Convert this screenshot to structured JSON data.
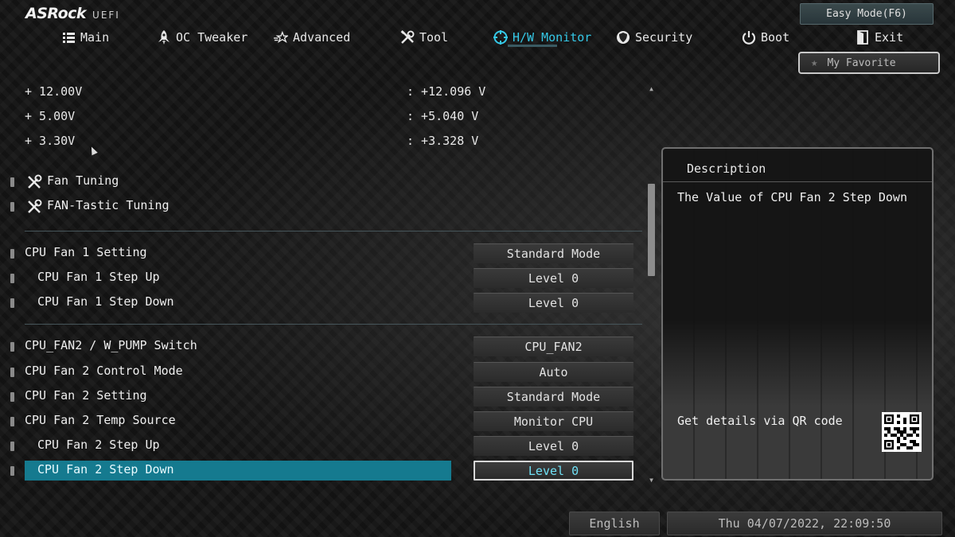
{
  "header": {
    "brand": "ASRock",
    "brand_suffix": "UEFI",
    "easy_mode_label": "Easy Mode(F6)",
    "favorite_label": "My Favorite"
  },
  "nav": {
    "active": "H/W Monitor",
    "items": [
      {
        "label": "Main",
        "icon": "list-icon"
      },
      {
        "label": "OC Tweaker",
        "icon": "rocket-icon"
      },
      {
        "label": "Advanced",
        "icon": "star-icon"
      },
      {
        "label": "Tool",
        "icon": "tools-icon"
      },
      {
        "label": "H/W Monitor",
        "icon": "target-icon"
      },
      {
        "label": "Security",
        "icon": "shield-icon"
      },
      {
        "label": "Boot",
        "icon": "power-icon"
      },
      {
        "label": "Exit",
        "icon": "exit-door-icon"
      }
    ]
  },
  "voltages": [
    {
      "name": "+ 12.00V",
      "value": ": +12.096 V"
    },
    {
      "name": "+ 5.00V",
      "value": ": +5.040 V"
    },
    {
      "name": "+ 3.30V",
      "value": ": +3.328 V"
    }
  ],
  "tuning": [
    {
      "label": "Fan Tuning"
    },
    {
      "label": "FAN-Tastic Tuning"
    }
  ],
  "fan1": [
    {
      "label": "CPU Fan 1 Setting",
      "value": "Standard Mode"
    },
    {
      "label": "CPU Fan 1 Step Up",
      "value": "Level 0"
    },
    {
      "label": "CPU Fan 1 Step Down",
      "value": "Level 0"
    }
  ],
  "fan2": [
    {
      "label": "CPU_FAN2 / W_PUMP Switch",
      "value": "CPU_FAN2"
    },
    {
      "label": "CPU Fan 2 Control Mode",
      "value": "Auto"
    },
    {
      "label": "CPU Fan 2 Setting",
      "value": "Standard Mode"
    },
    {
      "label": "CPU Fan 2 Temp Source",
      "value": "Monitor CPU"
    },
    {
      "label": "CPU Fan 2 Step Up",
      "value": "Level 0"
    },
    {
      "label": "CPU Fan 2 Step Down",
      "value": "Level 0"
    }
  ],
  "selected_item": "CPU Fan 2 Step Down",
  "description": {
    "title": "Description",
    "text": "The Value of CPU Fan 2 Step Down",
    "qr_text": "Get details via QR code"
  },
  "footer": {
    "language": "English",
    "datetime": "Thu 04/07/2022, 22:09:50"
  },
  "colors": {
    "accent": "#35c9e8",
    "selected_bg": "#157a8f",
    "background": "#141414"
  }
}
